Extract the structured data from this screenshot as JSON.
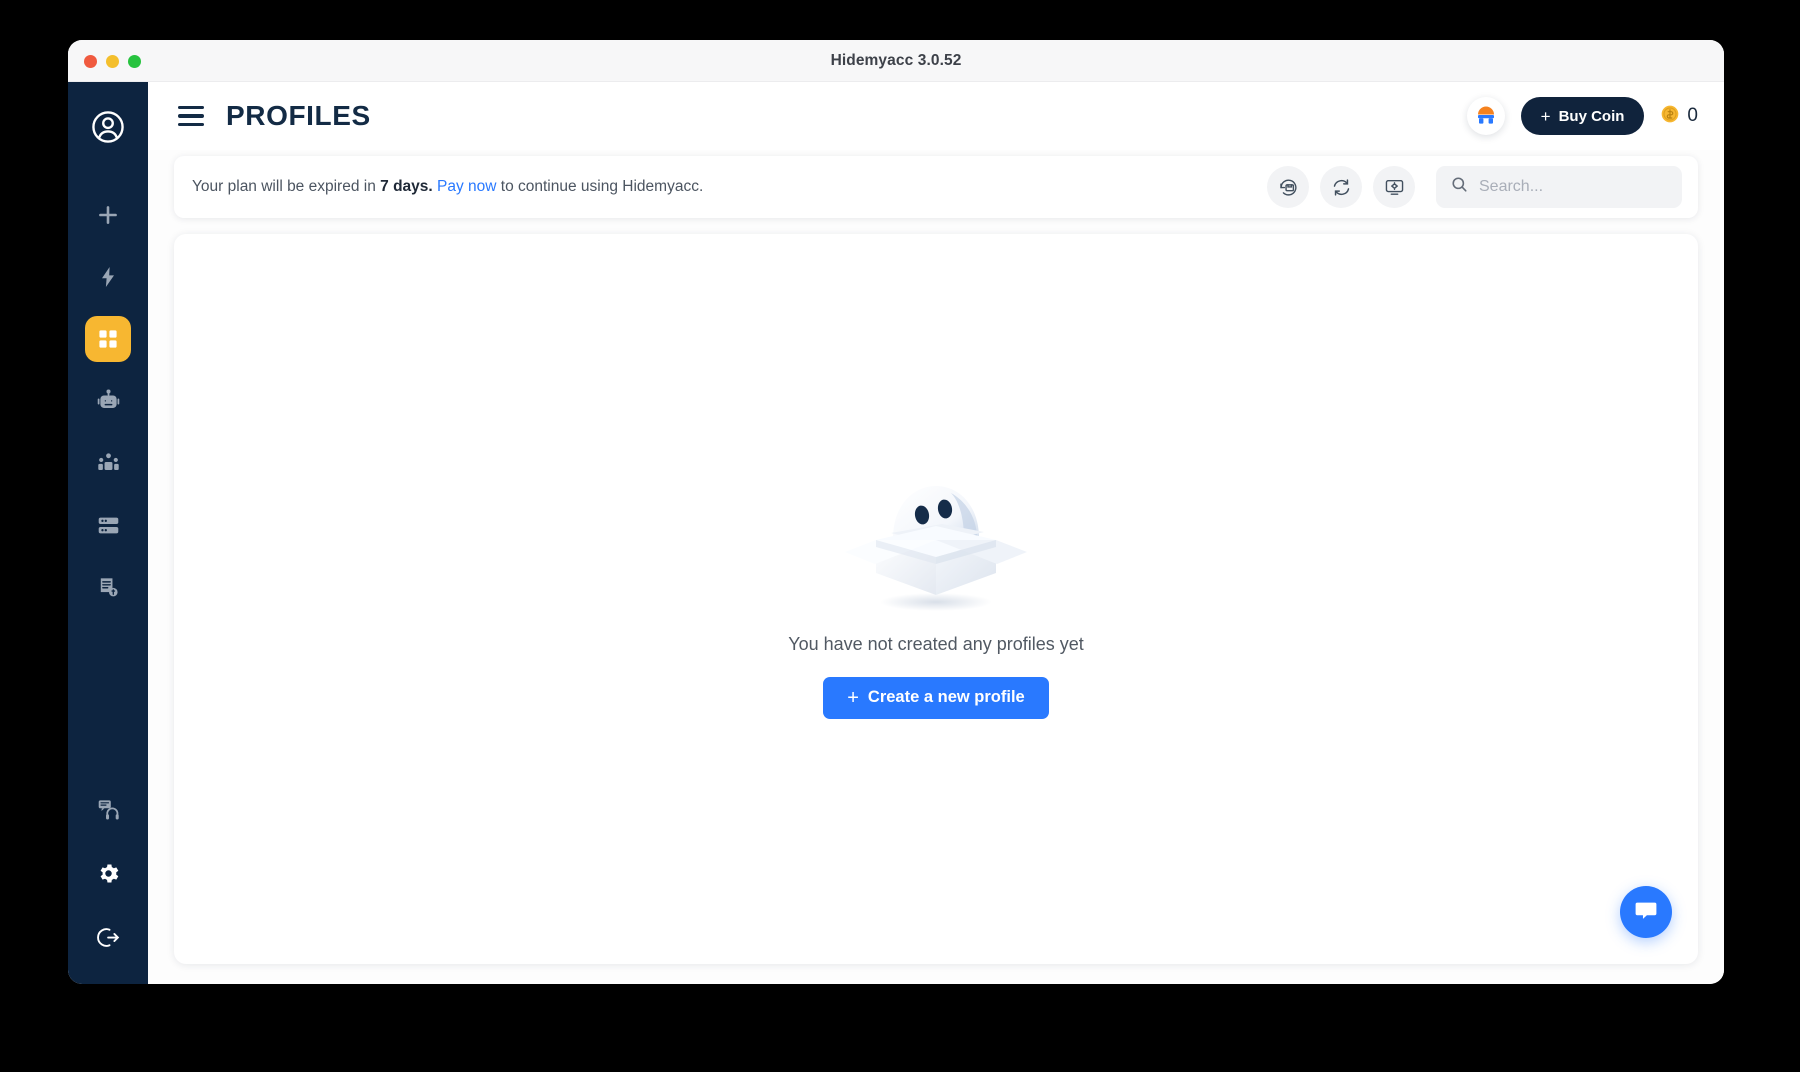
{
  "window": {
    "title": "Hidemyacc 3.0.52",
    "traffic_lights": [
      "close",
      "minimize",
      "maximize"
    ]
  },
  "sidebar": {
    "items": [
      {
        "name": "account",
        "icon": "user-circle-icon",
        "active": false
      },
      {
        "name": "new",
        "icon": "plus-icon",
        "active": false
      },
      {
        "name": "quick-actions",
        "icon": "lightning-icon",
        "active": false
      },
      {
        "name": "profiles",
        "icon": "grid-icon",
        "active": true
      },
      {
        "name": "automation",
        "icon": "robot-icon",
        "active": false
      },
      {
        "name": "team",
        "icon": "team-icon",
        "active": false
      },
      {
        "name": "proxy",
        "icon": "server-icon",
        "active": false
      },
      {
        "name": "billing",
        "icon": "invoice-icon",
        "active": false
      }
    ],
    "bottom_items": [
      {
        "name": "support",
        "icon": "headset-support-icon"
      },
      {
        "name": "settings",
        "icon": "gear-icon"
      },
      {
        "name": "logout",
        "icon": "logout-icon"
      }
    ],
    "active_color": "#f7b731",
    "background": "#0d2440"
  },
  "header": {
    "menu_icon": "hamburger-icon",
    "title": "PROFILES",
    "avatar_icon": "extension-avatar-icon",
    "buy_coin": {
      "plus": "+",
      "label": "Buy Coin"
    },
    "coin": {
      "icon": "coin-icon",
      "count": "0"
    }
  },
  "notice": {
    "prefix": "Your plan will be expired in ",
    "days": "7 days.",
    "link": "Pay now",
    "suffix": " to continue using Hidemyacc.",
    "actions": [
      {
        "name": "restore",
        "icon": "restore-backup-icon"
      },
      {
        "name": "sync",
        "icon": "sync-refresh-icon"
      },
      {
        "name": "display-setup",
        "icon": "monitor-settings-icon"
      }
    ]
  },
  "search": {
    "icon": "search-icon",
    "placeholder": "Search...",
    "value": ""
  },
  "empty_state": {
    "illustration": "ghost-in-open-box-illustration",
    "message": "You have not created any profiles yet",
    "button": {
      "plus": "+",
      "label": "Create a new profile"
    }
  },
  "chat": {
    "icon": "chat-bubble-icon"
  },
  "colors": {
    "accent_blue": "#2979ff",
    "sidebar": "#0d2440",
    "active_amber": "#f7b731",
    "dark_navy": "#10233c"
  }
}
